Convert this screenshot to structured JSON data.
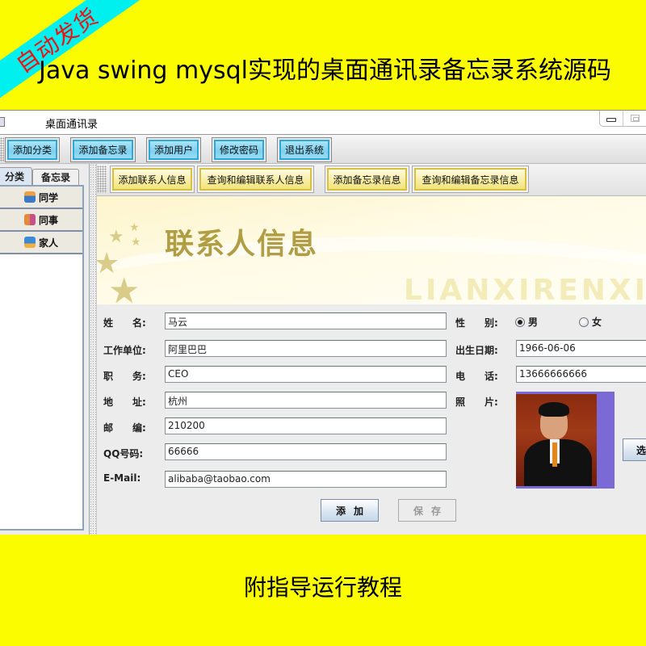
{
  "promo": {
    "ribbon_label": "自动发货",
    "headline": "Java swing mysql实现的桌面通讯录备忘录系统源码",
    "footer": "附指导运行教程",
    "colors": {
      "banner_bg": "#fcfc00",
      "ribbon_bg": "#00f0f0",
      "ribbon_text": "#f01010"
    }
  },
  "window": {
    "title": "桌面通讯录",
    "controls": {
      "minimize_icon": "minimize-icon",
      "maximize_icon": "maximize-icon"
    }
  },
  "toolbar": {
    "buttons": [
      {
        "label": "添加分类"
      },
      {
        "label": "添加备忘录"
      },
      {
        "label": "添加用户"
      },
      {
        "label": "修改密码"
      },
      {
        "label": "退出系统"
      }
    ]
  },
  "sidebar": {
    "tabs": [
      {
        "label": "分类",
        "active": true
      },
      {
        "label": "备忘录",
        "active": false
      }
    ],
    "categories": [
      {
        "label": "同学",
        "icon": "classmate-icon"
      },
      {
        "label": "同事",
        "icon": "colleague-icon"
      },
      {
        "label": "家人",
        "icon": "family-icon"
      }
    ]
  },
  "subtoolbar": {
    "buttons": [
      {
        "label": "添加联系人信息"
      },
      {
        "label": "查询和编辑联系人信息"
      },
      {
        "label": "添加备忘录信息"
      },
      {
        "label": "查询和编辑备忘录信息"
      }
    ]
  },
  "hero": {
    "title": "联系人信息",
    "watermark": "LIANXIRENXINXI"
  },
  "form": {
    "labels": {
      "name": "姓　　名:",
      "company": "工作单位:",
      "position": "职　　务:",
      "address": "地　　址:",
      "zipcode": "邮　　编:",
      "qq": "QQ号码:",
      "email": "E-Mail:",
      "gender": "性　　别:",
      "birthday": "出生日期:",
      "phone": "电　　话:",
      "photo": "照　　片:"
    },
    "values": {
      "name": "马云",
      "company": "阿里巴巴",
      "position": "CEO",
      "address": "杭州",
      "zipcode": "210200",
      "qq": "66666",
      "email": "alibaba@taobao.com",
      "birthday": "1966-06-06",
      "phone": "13666666666"
    },
    "gender_options": [
      {
        "label": "男",
        "selected": true
      },
      {
        "label": "女",
        "selected": false
      }
    ],
    "buttons": {
      "add": "添加",
      "save": "保存",
      "choose_photo": "选"
    }
  }
}
